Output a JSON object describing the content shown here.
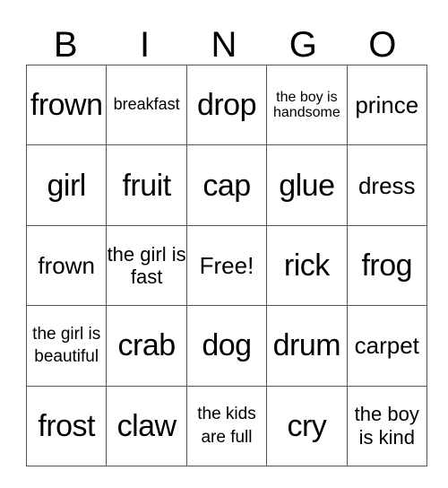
{
  "header": [
    "B",
    "I",
    "N",
    "G",
    "O"
  ],
  "rows": [
    [
      {
        "text": "frown",
        "size": "s1"
      },
      {
        "text": "breakfast",
        "size": "s4"
      },
      {
        "text": "drop",
        "size": "s1"
      },
      {
        "text": "the boy is handsome",
        "size": "s5"
      },
      {
        "text": "prince",
        "size": "s2"
      }
    ],
    [
      {
        "text": "girl",
        "size": "s1"
      },
      {
        "text": "fruit",
        "size": "s1"
      },
      {
        "text": "cap",
        "size": "s1"
      },
      {
        "text": "glue",
        "size": "s1"
      },
      {
        "text": "dress",
        "size": "s2"
      }
    ],
    [
      {
        "text": "frown",
        "size": "s2"
      },
      {
        "text": "the girl is fast",
        "size": "s3"
      },
      {
        "text": "Free!",
        "size": "s2"
      },
      {
        "text": "rick",
        "size": "s1"
      },
      {
        "text": "frog",
        "size": "s1"
      }
    ],
    [
      {
        "text": "the girl is beautiful",
        "size": "s6"
      },
      {
        "text": "crab",
        "size": "s1"
      },
      {
        "text": "dog",
        "size": "s1"
      },
      {
        "text": "drum",
        "size": "s1"
      },
      {
        "text": "carpet",
        "size": "s2"
      }
    ],
    [
      {
        "text": "frost",
        "size": "s1"
      },
      {
        "text": "claw",
        "size": "s1"
      },
      {
        "text": "the kids are full",
        "size": "s6"
      },
      {
        "text": "cry",
        "size": "s1"
      },
      {
        "text": "the boy is kind",
        "size": "s3"
      }
    ]
  ]
}
